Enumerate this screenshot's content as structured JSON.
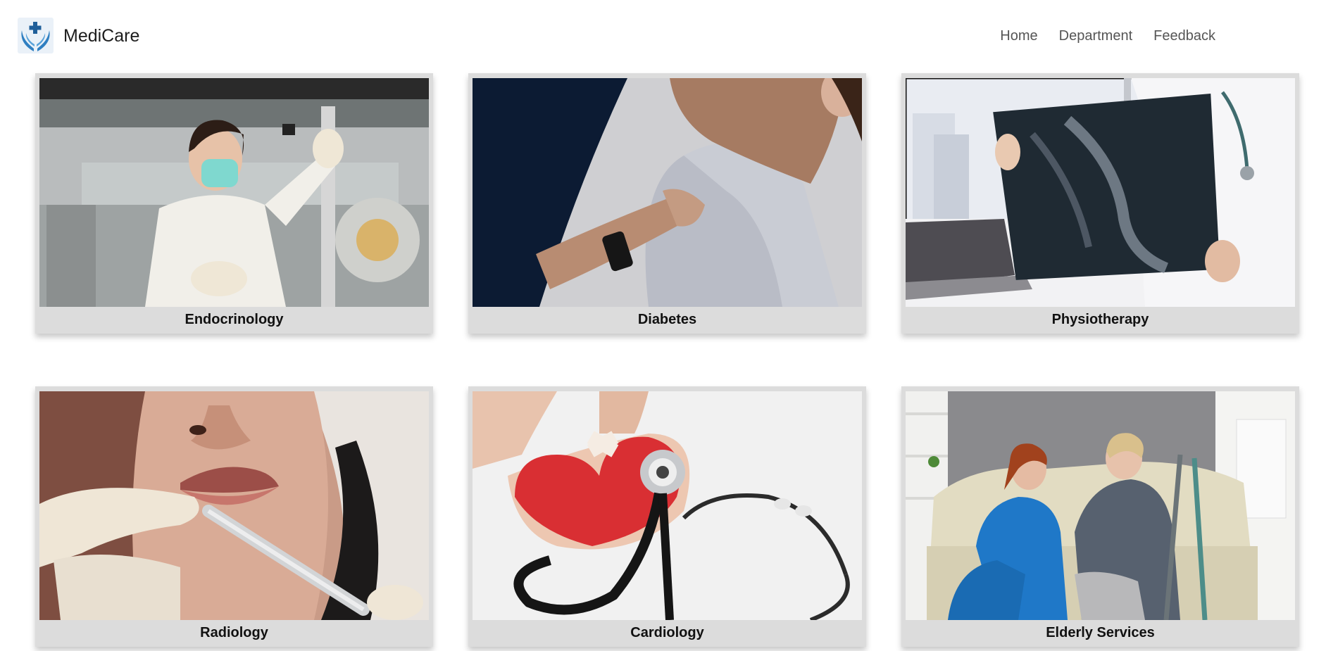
{
  "header": {
    "brand": "MediCare",
    "logo_icon": "hands-cross-icon",
    "nav": [
      "Home",
      "Department",
      "Feedback"
    ]
  },
  "departments": [
    {
      "label": "Endocrinology",
      "image": "lab-doctor-photo"
    },
    {
      "label": "Diabetes",
      "image": "shoulder-therapy-photo"
    },
    {
      "label": "Physiotherapy",
      "image": "xray-review-photo"
    },
    {
      "label": "Radiology",
      "image": "lip-injection-photo"
    },
    {
      "label": "Cardiology",
      "image": "heart-stethoscope-photo"
    },
    {
      "label": "Elderly Services",
      "image": "nurse-elderly-photo"
    }
  ],
  "colors": {
    "card_bg": "#dcdcdc",
    "logo_blue": "#2f7fc1",
    "nav_text": "#555555"
  }
}
